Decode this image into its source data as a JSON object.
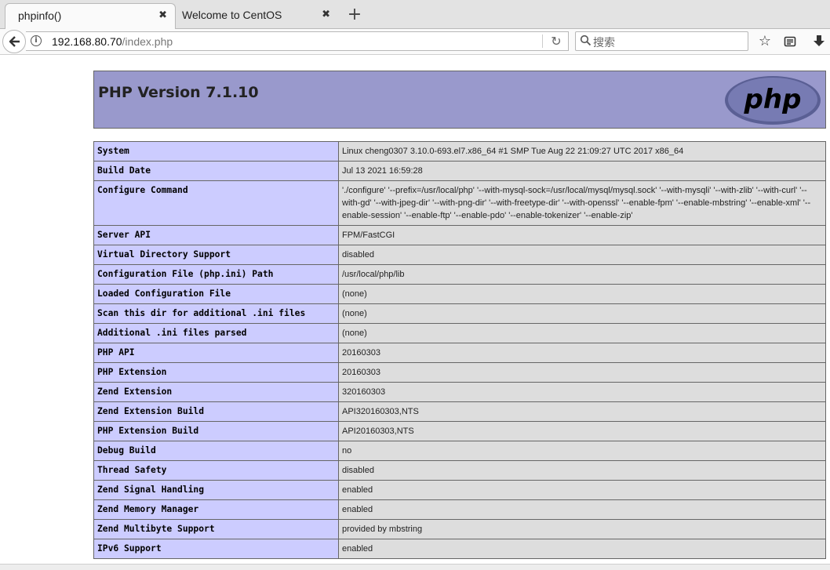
{
  "tabs": [
    {
      "title": "phpinfo()",
      "active": true
    },
    {
      "title": "Welcome to CentOS",
      "active": false
    }
  ],
  "toolbar": {
    "url_host": "192.168.80.70",
    "url_path": "/index.php",
    "search_placeholder": "搜索",
    "icons": [
      "back-icon",
      "info-icon",
      "reload-icon",
      "search-icon",
      "bookmark-star-icon",
      "reader-view-icon",
      "download-icon",
      "new-tab-icon",
      "close-icon"
    ]
  },
  "page": {
    "version_title": "PHP Version 7.1.10",
    "logo_text": "php",
    "rows": [
      {
        "label": "System",
        "value": "Linux cheng0307 3.10.0-693.el7.x86_64 #1 SMP Tue Aug 22 21:09:27 UTC 2017 x86_64"
      },
      {
        "label": "Build Date",
        "value": "Jul 13 2021 16:59:28"
      },
      {
        "label": "Configure Command",
        "value": "'./configure' '--prefix=/usr/local/php' '--with-mysql-sock=/usr/local/mysql/mysql.sock' '--with-mysqli' '--with-zlib' '--with-curl' '--with-gd' '--with-jpeg-dir' '--with-png-dir' '--with-freetype-dir' '--with-openssl' '--enable-fpm' '--enable-mbstring' '--enable-xml' '--enable-session' '--enable-ftp' '--enable-pdo' '--enable-tokenizer' '--enable-zip'"
      },
      {
        "label": "Server API",
        "value": "FPM/FastCGI"
      },
      {
        "label": "Virtual Directory Support",
        "value": "disabled"
      },
      {
        "label": "Configuration File (php.ini) Path",
        "value": "/usr/local/php/lib"
      },
      {
        "label": "Loaded Configuration File",
        "value": "(none)"
      },
      {
        "label": "Scan this dir for additional .ini files",
        "value": "(none)"
      },
      {
        "label": "Additional .ini files parsed",
        "value": "(none)"
      },
      {
        "label": "PHP API",
        "value": "20160303"
      },
      {
        "label": "PHP Extension",
        "value": "20160303"
      },
      {
        "label": "Zend Extension",
        "value": "320160303"
      },
      {
        "label": "Zend Extension Build",
        "value": "API320160303,NTS"
      },
      {
        "label": "PHP Extension Build",
        "value": "API20160303,NTS"
      },
      {
        "label": "Debug Build",
        "value": "no"
      },
      {
        "label": "Thread Safety",
        "value": "disabled"
      },
      {
        "label": "Zend Signal Handling",
        "value": "enabled"
      },
      {
        "label": "Zend Memory Manager",
        "value": "enabled"
      },
      {
        "label": "Zend Multibyte Support",
        "value": "provided by mbstring"
      },
      {
        "label": "IPv6 Support",
        "value": "enabled"
      }
    ]
  }
}
